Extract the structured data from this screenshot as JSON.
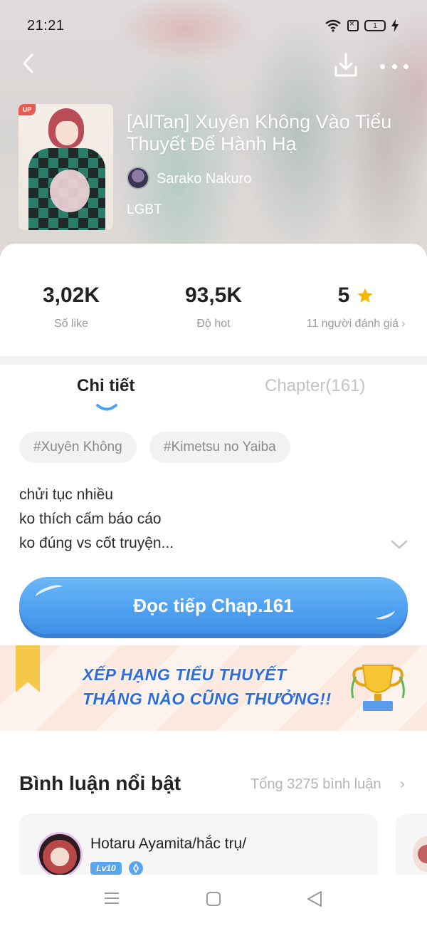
{
  "status_bar": {
    "time": "21:21",
    "battery_level": "1"
  },
  "story": {
    "badge": "UP",
    "title": "[AllTan] Xuyên Không Vào Tiểu Thuyết Để Hành Hạ",
    "author": "Sarako Nakuro",
    "genre": "LGBT"
  },
  "stats": {
    "likes": {
      "value": "3,02K",
      "label": "Số like"
    },
    "hot": {
      "value": "93,5K",
      "label": "Độ hot"
    },
    "rating": {
      "value": "5",
      "label": "11 người đánh giá"
    }
  },
  "tabs": {
    "detail": "Chi tiết",
    "chapter": "Chapter(161)"
  },
  "tags": [
    "#Xuyên Không",
    "#Kimetsu no Yaiba"
  ],
  "description": [
    "chửi tục nhiều",
    "ko thích cấm báo cáo",
    "ko đúng vs cốt truyện..."
  ],
  "read_button": "Đọc tiếp Chap.161",
  "banner": {
    "line1": "XẾP HẠNG TIỂU THUYẾT",
    "line2": "THÁNG NÀO CŨNG THƯỞNG!!"
  },
  "comments": {
    "title": "Bình luận nổi bật",
    "total": "Tổng 3275 bình luận",
    "items": [
      {
        "user": "Hotaru Ayamita/hắc trụ/",
        "level": "Lv10"
      }
    ]
  },
  "colors": {
    "accent": "#4e9ff0",
    "star": "#f6b800",
    "banner_text": "#2f6bd9"
  },
  "icons": [
    "back-icon",
    "download-icon",
    "more-icon",
    "star-icon",
    "chevron-down-icon",
    "trophy-icon",
    "menu-icon",
    "home-icon",
    "back-triangle-icon"
  ]
}
